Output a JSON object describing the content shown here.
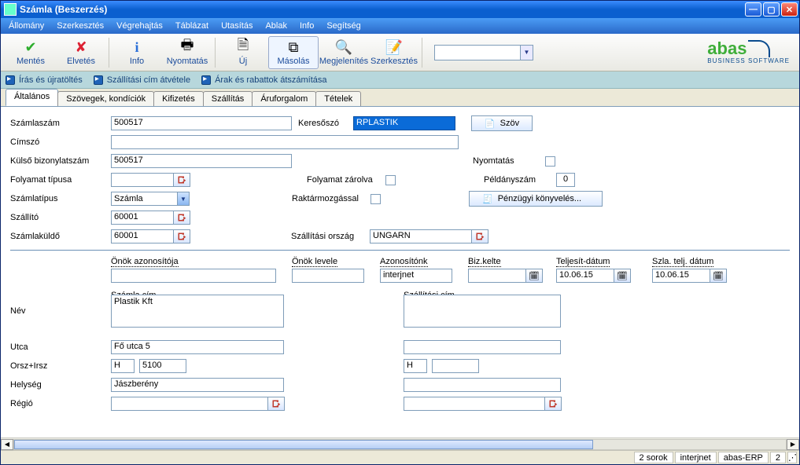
{
  "window": {
    "title": "Számla (Beszerzés)"
  },
  "menu": {
    "allomany": "Állomány",
    "szerkesztes": "Szerkesztés",
    "vegrehajtas": "Végrehajtás",
    "tablazat": "Táblázat",
    "utasitas": "Utasítás",
    "ablak": "Ablak",
    "info": "Info",
    "segitseg": "Segítség"
  },
  "toolbar": {
    "mentes": "Mentés",
    "elvetes": "Elvetés",
    "info": "Info",
    "nyomtatas": "Nyomtatás",
    "uj": "Új",
    "masolas": "Másolás",
    "megjelenites": "Megjelenítés",
    "szerkesztes": "Szerkesztés"
  },
  "brand": {
    "name": "abas",
    "sub": "BUSINESS SOFTWARE"
  },
  "quick": {
    "iras": "Írás és újratöltés",
    "szall": "Szállítási cím átvétele",
    "arak": "Árak és rabattok átszámítása"
  },
  "tabs": {
    "altalanos": "Általános",
    "szovegek": "Szövegek, kondíciók",
    "kifizetes": "Kifizetés",
    "szallitas": "Szállítás",
    "aruforgalom": "Áruforgalom",
    "tetelek": "Tételek"
  },
  "fields": {
    "szamlaszam_l": "Számlaszám",
    "szamlaszam_v": "500517",
    "keresoszo_l": "Keresőszó",
    "keresoszo_v": "RPLASTIK",
    "szov_btn": "Szöv",
    "cimszo_l": "Címszó",
    "cimszo_v": "",
    "kulsobiz_l": "Külső bizonylatszám",
    "kulsobiz_v": "500517",
    "nyomtatas_l": "Nyomtatás",
    "folyamattip_l": "Folyamat típusa",
    "folyamattip_v": "",
    "folyamatzar_l": "Folyamat zárolva",
    "peldanyszam_l": "Példányszám",
    "peldanyszam_v": "0",
    "szamlatipus_l": "Számlatípus",
    "szamlatipus_v": "Számla",
    "raktarmozg_l": "Raktármozgással",
    "penzugyi_btn": "Pénzügyi könyvelés...",
    "szallito_l": "Szállító",
    "szallito_v": "60001",
    "szamlakuldo_l": "Számlaküldő",
    "szamlakuldo_v": "60001",
    "szallorszag_l": "Szállítási ország",
    "szallorszag_v": "UNGARN"
  },
  "mini": {
    "onazon_l": "Önök azonosítója",
    "onazon_v": "",
    "onlevele_l": "Önök levele",
    "onlevele_v": "",
    "azonositonk_l": "Azonosítónk",
    "azonositonk_v": "interjnet",
    "bizkelte_l": "Biz.kelte",
    "bizkelte_v": "",
    "teljdatum_l": "Teljesít-dátum",
    "teljdatum_v": "10.06.15",
    "szlatelj_l": "Szla. telj. dátum",
    "szlatelj_v": "10.06.15"
  },
  "addr": {
    "szamla_cim_l": "Számla cím",
    "szallitasi_cim_l": "Szállítási cím",
    "nev_l": "Név",
    "nev_v": "Plastik Kft",
    "utca_l": "Utca",
    "utca_v": "Fő utca 5",
    "orszag_l": "Orsz+Irsz",
    "orsz_v": "H",
    "irsz_v": "5100",
    "sorsz_v": "H",
    "sirsz_v": "",
    "helyseg_l": "Helység",
    "helyseg_v": "Jászberény",
    "regio_l": "Régió",
    "regio_v": ""
  },
  "status": {
    "sorok": "2 sorok",
    "user": "interjnet",
    "sys": "abas-ERP",
    "num": "2"
  }
}
